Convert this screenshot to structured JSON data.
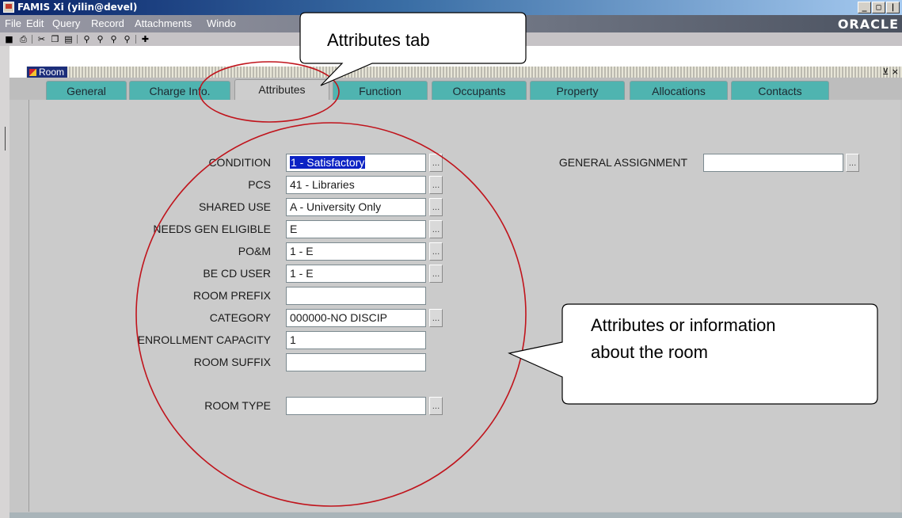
{
  "window": {
    "title": "FAMIS Xi (yilin@devel)",
    "min_label": "_",
    "max_label": "□",
    "close_label": "|"
  },
  "menu": [
    "File",
    "Edit",
    "Query",
    "Record",
    "Attachments",
    "Windo"
  ],
  "brand": "ORACLE",
  "form_title": "Room",
  "form_close": "⊻ ×",
  "tabs": [
    {
      "label": "General"
    },
    {
      "label": "Charge Info."
    },
    {
      "label": "Attributes"
    },
    {
      "label": "Function"
    },
    {
      "label": "Occupants"
    },
    {
      "label": "Property"
    },
    {
      "label": "Allocations"
    },
    {
      "label": "Contacts"
    }
  ],
  "fields": [
    {
      "label": "CONDITION",
      "value": "1 - Satisfactory",
      "lov": true,
      "selected": true
    },
    {
      "label": "PCS",
      "value": "41 - Libraries",
      "lov": true
    },
    {
      "label": "SHARED USE",
      "value": "A - University Only",
      "lov": true
    },
    {
      "label": "NEEDS GEN ELIGIBLE",
      "value": "E",
      "lov": true
    },
    {
      "label": "PO&M",
      "value": "1 - E",
      "lov": true
    },
    {
      "label": "BE CD USER",
      "value": "1 - E",
      "lov": true
    },
    {
      "label": "ROOM PREFIX",
      "value": "",
      "lov": false
    },
    {
      "label": "CATEGORY",
      "value": "000000-NO DISCIP",
      "lov": true
    },
    {
      "label": "ENROLLMENT CAPACITY",
      "value": "1",
      "lov": false
    },
    {
      "label": "ROOM SUFFIX",
      "value": "",
      "lov": false
    },
    {
      "label": "ROOM TYPE",
      "value": "",
      "lov": true
    }
  ],
  "general_assignment": {
    "label": "GENERAL ASSIGNMENT",
    "value": ""
  },
  "lov_label": "...",
  "callouts": {
    "tab_note": "Attributes tab",
    "room_note_line1": "Attributes or information",
    "room_note_line2": "about the room"
  },
  "colors": {
    "tab": "#4fb4b0",
    "selection": "#0b22c4",
    "annotation_circle": "#c0141c"
  }
}
